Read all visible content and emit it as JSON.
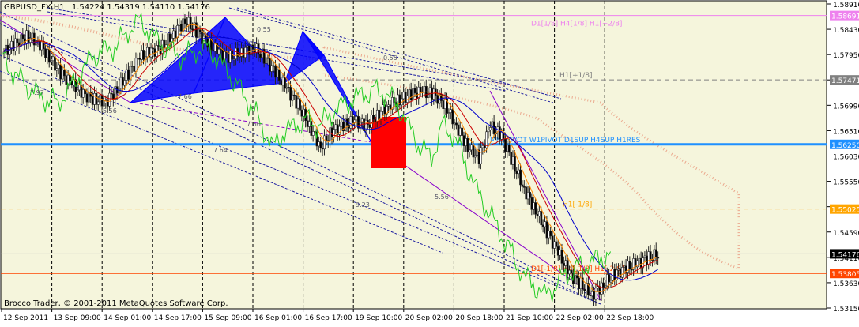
{
  "header": {
    "symbol": "GBPUSD_FX,H1",
    "ohlc": "1.54224 1.54319 1.54110 1.54176"
  },
  "colors": {
    "background": "#F5F5DC",
    "grid": "#000000",
    "price_tag_current": "#000000",
    "price_tag_blue": "#1E90FF",
    "price_tag_orange": "#FFA500",
    "price_tag_red": "#FF4500",
    "price_tag_magenta": "#EE82EE",
    "price_tag_gray": "#808080",
    "pattern_fill": "#0000FF",
    "box_fill": "#FF0000"
  },
  "price_axis": {
    "min": 1.5315,
    "max": 1.5891,
    "labels": [
      "1.58910",
      "1.58430",
      "1.57950",
      "1.57471",
      "1.56990",
      "1.56510",
      "1.56030",
      "1.55550",
      "1.55070",
      "1.54590",
      "1.54110",
      "1.53630",
      "1.53150"
    ]
  },
  "time_axis": {
    "labels": [
      "12 Sep 2011",
      "13 Sep 09:00",
      "14 Sep 01:00",
      "14 Sep 17:00",
      "15 Sep 09:00",
      "16 Sep 01:00",
      "16 Sep 17:00",
      "19 Sep 10:00",
      "20 Sep 02:00",
      "20 Sep 18:00",
      "21 Sep 10:00",
      "22 Sep 02:00",
      "22 Sep 18:00"
    ]
  },
  "price_levels": [
    {
      "name": "d1-murrey",
      "price": 1.58691,
      "label": "1.58691",
      "text": "D1[1/8] H4[1/8] H1[+2/8]",
      "color": "#EE82EE",
      "style": "solid"
    },
    {
      "name": "h1-murrey",
      "price": 1.57471,
      "label": "1.57471",
      "text": "H1[+1/8]",
      "color": "#808080",
      "style": "dash"
    },
    {
      "name": "pivot",
      "price": 1.5625,
      "label": "1.56250",
      "text": "MN1PIVOT W1PIVOT D1SUP H4SUP H1RES",
      "color": "#1E90FF",
      "style": "thick"
    },
    {
      "name": "h1-level",
      "price": 1.55025,
      "label": "1.55025",
      "text": "H1[-1/8]",
      "color": "#FFA500",
      "style": "dash"
    },
    {
      "name": "d1-low",
      "price": 1.53805,
      "label": "1.53805",
      "text": "D1[-1/8] H4[-1/8] H1[-2/8]",
      "color": "#FF4500",
      "style": "solid"
    }
  ],
  "current_price": {
    "price": 1.54176,
    "label": "1.54176"
  },
  "fib_labels": [
    {
      "text": "7.97"
    },
    {
      "text": "5.56"
    },
    {
      "text": "7.64"
    },
    {
      "text": "9.23"
    },
    {
      "text": "5.56"
    },
    {
      "text": "0.55"
    },
    {
      "text": "7.66"
    },
    {
      "text": "7.66"
    },
    {
      "text": "0.55"
    }
  ],
  "footer": {
    "copyright": "Brocco Trader, © 2001-2011 MetaQuotes Software Corp."
  },
  "chart_data": {
    "type": "line",
    "title": "GBPUSD_FX,H1",
    "ylim": [
      1.5315,
      1.5891
    ],
    "series": [
      {
        "name": "close",
        "values": [
          1.58,
          1.5815,
          1.583,
          1.582,
          1.579,
          1.576,
          1.574,
          1.572,
          1.571,
          1.5705,
          1.573,
          1.576,
          1.579,
          1.58,
          1.581,
          1.5835,
          1.586,
          1.584,
          1.5815,
          1.58,
          1.579,
          1.58,
          1.581,
          1.579,
          1.576,
          1.573,
          1.57,
          1.566,
          1.562,
          1.565,
          1.566,
          1.567,
          1.566,
          1.568,
          1.57,
          1.571,
          1.572,
          1.5725,
          1.572,
          1.57,
          1.566,
          1.562,
          1.56,
          1.566,
          1.564,
          1.559,
          1.554,
          1.55,
          1.546,
          1.542,
          1.538,
          1.536,
          1.534,
          1.536,
          1.538,
          1.539,
          1.54,
          1.541,
          1.5418
        ]
      }
    ]
  }
}
